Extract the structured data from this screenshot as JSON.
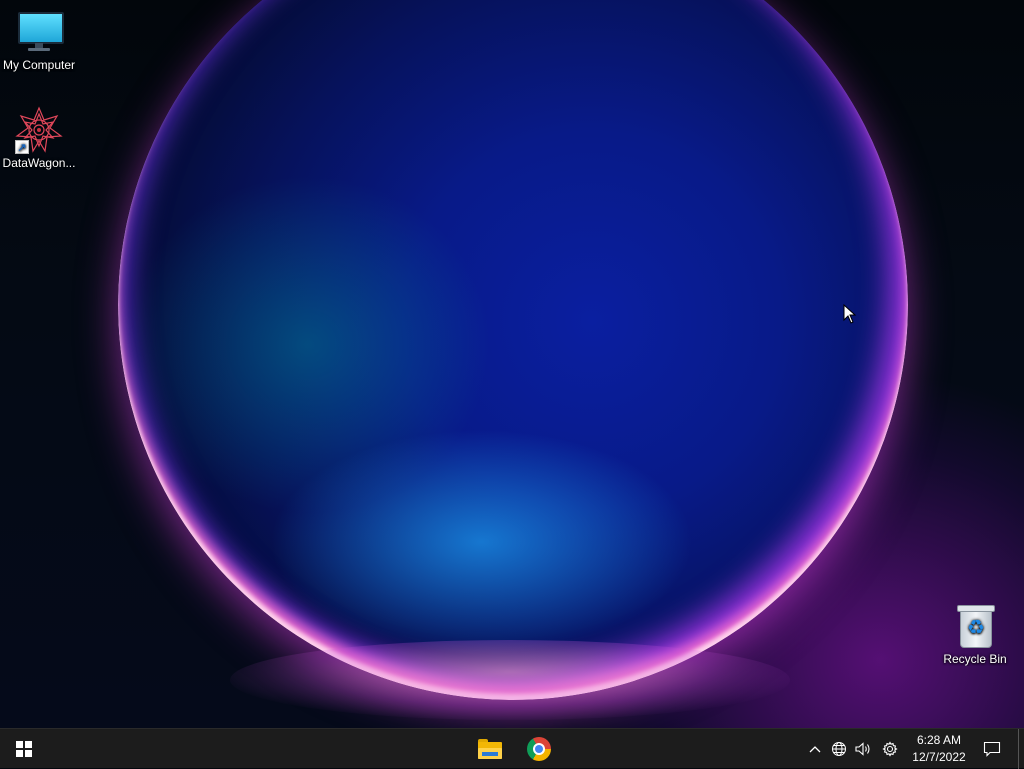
{
  "desktop": {
    "icons": [
      {
        "label": "My Computer",
        "icon": "monitor-icon"
      },
      {
        "label": "DataWagon...",
        "icon": "datawagon-logo-icon"
      },
      {
        "label": "Recycle Bin",
        "icon": "recycle-bin-icon"
      }
    ]
  },
  "taskbar": {
    "start_icon": "windows-logo-icon",
    "pinned": [
      {
        "name": "File Explorer",
        "icon": "folder-icon"
      },
      {
        "name": "Google Chrome",
        "icon": "chrome-icon"
      }
    ],
    "tray": {
      "icons": [
        "chevron-up-icon",
        "globe-icon",
        "volume-icon",
        "gear-icon"
      ],
      "time": "6:28 AM",
      "date": "12/7/2022",
      "notification_icon": "notification-icon"
    }
  },
  "colors": {
    "taskbar_bg": "#1c1c1c",
    "orb_rim": "#ff78c8",
    "glow_purple": "#9614be"
  }
}
